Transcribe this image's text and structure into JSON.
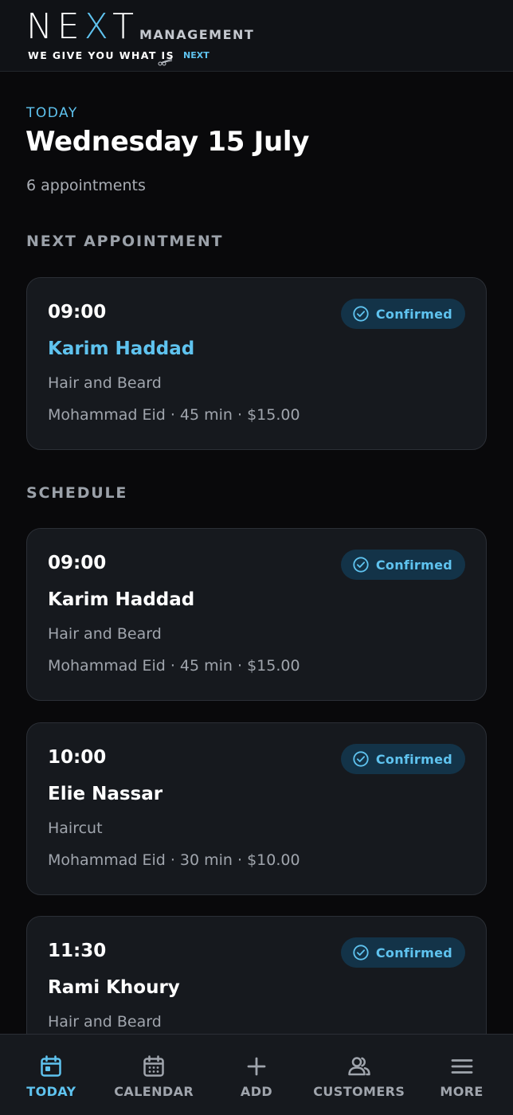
{
  "brand": {
    "logo_word_a": "NE",
    "logo_word_x": "X",
    "logo_word_b": "T",
    "subtitle": "MANAGEMENT",
    "tagline": "WE GIVE YOU WHAT IS",
    "tagline_accent": "NEXT"
  },
  "day": {
    "label": "TODAY",
    "date": "Wednesday 15 July",
    "count": "6 appointments"
  },
  "sections": {
    "next": "NEXT APPOINTMENT",
    "schedule": "SCHEDULE"
  },
  "next_appointment": {
    "time": "09:00",
    "client": "Karim Haddad",
    "service": "Hair and Beard",
    "meta": "Mohammad Eid · 45 min · $15.00",
    "status": "Confirmed"
  },
  "schedule": [
    {
      "time": "09:00",
      "client": "Karim Haddad",
      "service": "Hair and Beard",
      "meta": "Mohammad Eid · 45 min · $15.00",
      "status": "Confirmed"
    },
    {
      "time": "10:00",
      "client": "Elie Nassar",
      "service": "Haircut",
      "meta": "Mohammad Eid · 30 min · $10.00",
      "status": "Confirmed"
    },
    {
      "time": "11:30",
      "client": "Rami Khoury",
      "service": "Hair and Beard",
      "meta": "",
      "status": "Confirmed"
    }
  ],
  "nav": [
    {
      "label": "TODAY",
      "icon": "calendar-today-icon",
      "active": true
    },
    {
      "label": "CALENDAR",
      "icon": "calendar-grid-icon",
      "active": false
    },
    {
      "label": "ADD",
      "icon": "plus-icon",
      "active": false
    },
    {
      "label": "CUSTOMERS",
      "icon": "users-icon",
      "active": false
    },
    {
      "label": "MORE",
      "icon": "menu-icon",
      "active": false
    }
  ],
  "colors": {
    "accent": "#5fc3ef",
    "background": "#09090b",
    "card": "#16191e",
    "badge_bg": "#133348"
  }
}
